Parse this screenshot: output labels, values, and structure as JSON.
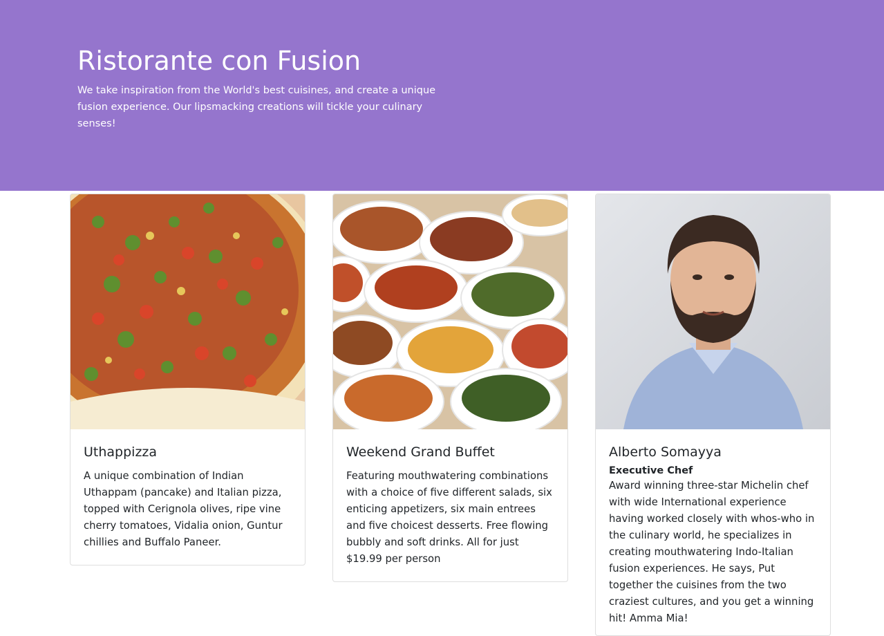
{
  "jumbotron": {
    "title": "Ristorante con Fusion",
    "text": "We take inspiration from the World's best cuisines, and create a unique fusion experience. Our lipsmacking creations will tickle your culinary senses!",
    "bg_color": "#9575cd"
  },
  "cards": [
    {
      "image": "uthappizza-photo",
      "title": "Uthappizza",
      "text": "A unique combination of Indian Uthappam (pancake) and Italian pizza, topped with Cerignola olives, ripe vine cherry tomatoes, Vidalia onion, Guntur chillies and Buffalo Paneer."
    },
    {
      "image": "buffet-photo",
      "title": "Weekend Grand Buffet",
      "text": "Featuring mouthwatering combinations with a choice of five different salads, six enticing appetizers, six main entrees and five choicest desserts. Free flowing bubbly and soft drinks. All for just $19.99 per person"
    },
    {
      "image": "chef-photo",
      "title": "Alberto Somayya",
      "subtitle": "Executive Chef",
      "text": "Award winning three-star Michelin chef with wide International experience having worked closely with whos-who in the culinary world, he specializes in creating mouthwatering Indo-Italian fusion experiences. He says, Put together the cuisines from the two craziest cultures, and you get a winning hit! Amma Mia!"
    }
  ]
}
